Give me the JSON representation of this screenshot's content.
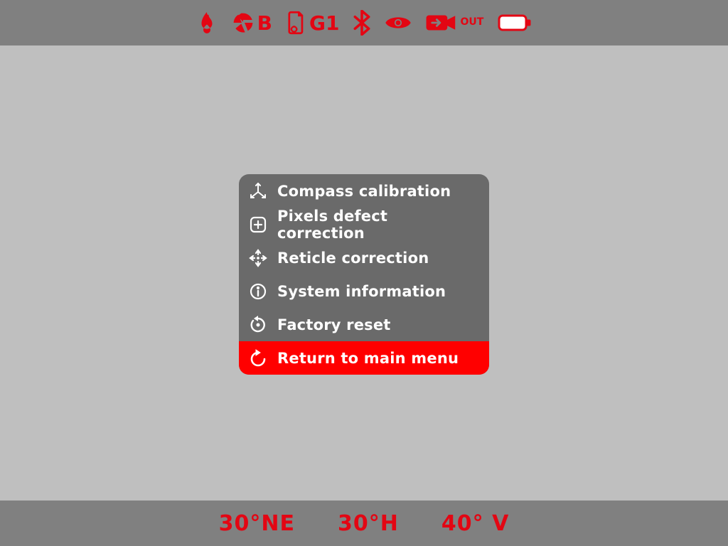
{
  "statusbar": {
    "mode_label": "B",
    "profile_label": "G1",
    "video_out_suffix": "OUT"
  },
  "menu": {
    "items": [
      {
        "label": "Compass calibration",
        "icon": "axes-icon",
        "selected": false
      },
      {
        "label": "Pixels defect correction",
        "icon": "plus-square-icon",
        "selected": false
      },
      {
        "label": "Reticle correction",
        "icon": "reticle-icon",
        "selected": false
      },
      {
        "label": "System information",
        "icon": "info-icon",
        "selected": false
      },
      {
        "label": "Factory reset",
        "icon": "reset-icon",
        "selected": false
      },
      {
        "label": "Return to main menu",
        "icon": "return-icon",
        "selected": true
      }
    ]
  },
  "compass": {
    "heading": "30°NE",
    "horizontal": "30°H",
    "vertical": "40° V"
  }
}
